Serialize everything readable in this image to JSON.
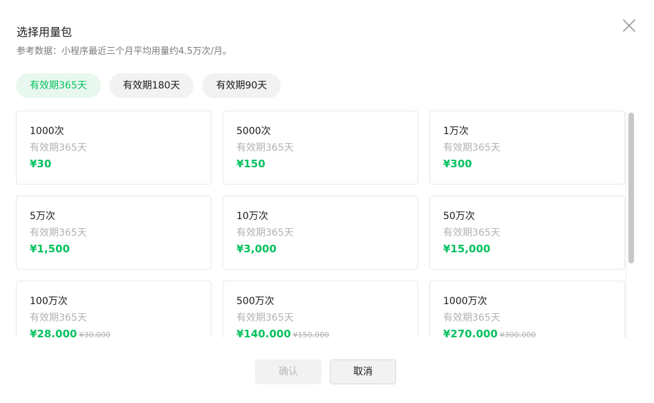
{
  "dialog": {
    "title": "选择用量包",
    "subtitle": "参考数据：小程序最近三个月平均用量约4.5万次/月。",
    "close_icon": "close-icon"
  },
  "tabs": [
    {
      "label": "有效期365天",
      "active": true
    },
    {
      "label": "有效期180天",
      "active": false
    },
    {
      "label": "有效期90天",
      "active": false
    }
  ],
  "packages": [
    {
      "amount": "1000次",
      "validity": "有效期365天",
      "price": "¥30",
      "original_price": ""
    },
    {
      "amount": "5000次",
      "validity": "有效期365天",
      "price": "¥150",
      "original_price": ""
    },
    {
      "amount": "1万次",
      "validity": "有效期365天",
      "price": "¥300",
      "original_price": ""
    },
    {
      "amount": "5万次",
      "validity": "有效期365天",
      "price": "¥1,500",
      "original_price": ""
    },
    {
      "amount": "10万次",
      "validity": "有效期365天",
      "price": "¥3,000",
      "original_price": ""
    },
    {
      "amount": "50万次",
      "validity": "有效期365天",
      "price": "¥15,000",
      "original_price": ""
    },
    {
      "amount": "100万次",
      "validity": "有效期365天",
      "price": "¥28,000",
      "original_price": "¥30,000"
    },
    {
      "amount": "500万次",
      "validity": "有效期365天",
      "price": "¥140,000",
      "original_price": "¥150,000"
    },
    {
      "amount": "1000万次",
      "validity": "有效期365天",
      "price": "¥270,000",
      "original_price": "¥300,000"
    }
  ],
  "footer": {
    "confirm_label": "确认",
    "cancel_label": "取消"
  },
  "colors": {
    "accent": "#07c160",
    "active_tab_bg": "#e8f8ee",
    "muted_text": "#b2b2b2"
  }
}
